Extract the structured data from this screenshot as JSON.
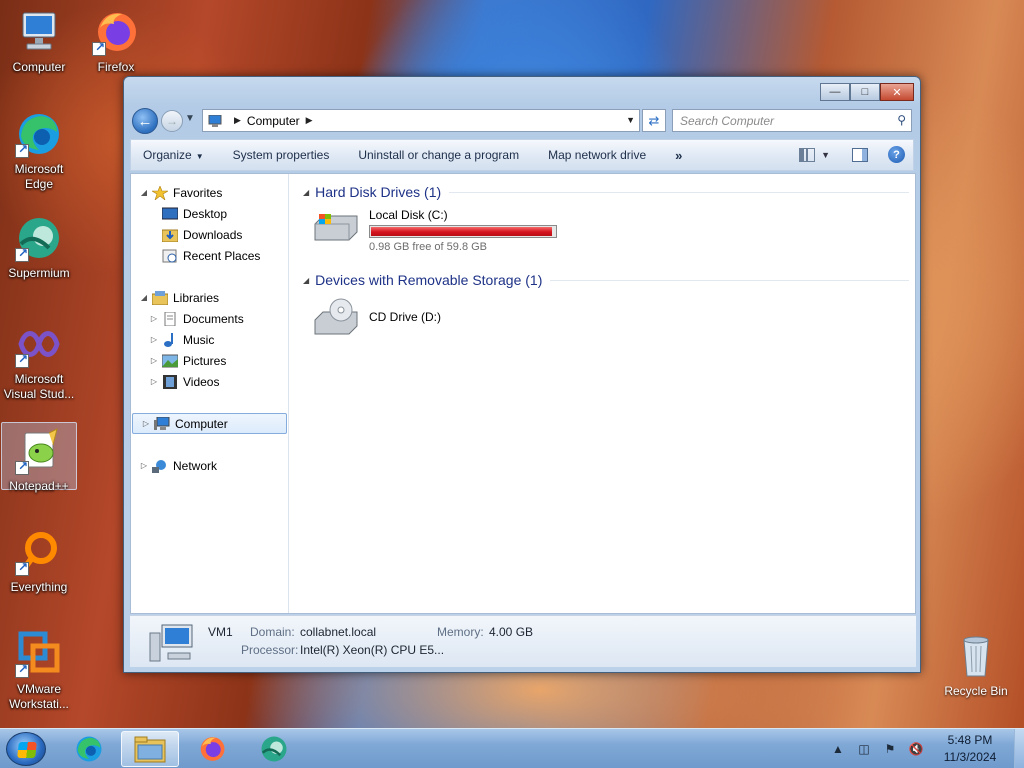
{
  "desktop": {
    "icons": [
      {
        "label": "Computer"
      },
      {
        "label": "Firefox"
      },
      {
        "label": "Microsoft Edge"
      },
      {
        "label": "Supermium"
      },
      {
        "label": "Microsoft Visual Stud..."
      },
      {
        "label": "Notepad++"
      },
      {
        "label": "Everything"
      },
      {
        "label": "VMware Workstati..."
      },
      {
        "label": "Recycle Bin"
      }
    ]
  },
  "window": {
    "address": {
      "location": "Computer"
    },
    "search": {
      "placeholder": "Search Computer"
    },
    "toolbar": {
      "organize": "Organize",
      "system_properties": "System properties",
      "uninstall": "Uninstall or change a program",
      "map_drive": "Map network drive",
      "more": "»"
    },
    "nav": {
      "favorites": "Favorites",
      "desktop": "Desktop",
      "downloads": "Downloads",
      "recent": "Recent Places",
      "libraries": "Libraries",
      "documents": "Documents",
      "music": "Music",
      "pictures": "Pictures",
      "videos": "Videos",
      "computer": "Computer",
      "network": "Network"
    },
    "groups": {
      "hdd": "Hard Disk Drives (1)",
      "removable": "Devices with Removable Storage (1)"
    },
    "drives": {
      "c_name": "Local Disk (C:)",
      "c_free": "0.98 GB free of 59.8 GB",
      "c_used_fraction": 0.984,
      "d_name": "CD Drive (D:)"
    },
    "details": {
      "name": "VM1",
      "domain_label": "Domain:",
      "domain": "collabnet.local",
      "memory_label": "Memory:",
      "memory": "4.00 GB",
      "processor_label": "Processor:",
      "processor": "Intel(R) Xeon(R) CPU E5..."
    }
  },
  "taskbar": {
    "time": "5:48 PM",
    "date": "11/3/2024"
  },
  "colors": {
    "disk_bar_full": "#d6141e",
    "group_header": "#1e3287",
    "selection_border": "#84acdd"
  }
}
